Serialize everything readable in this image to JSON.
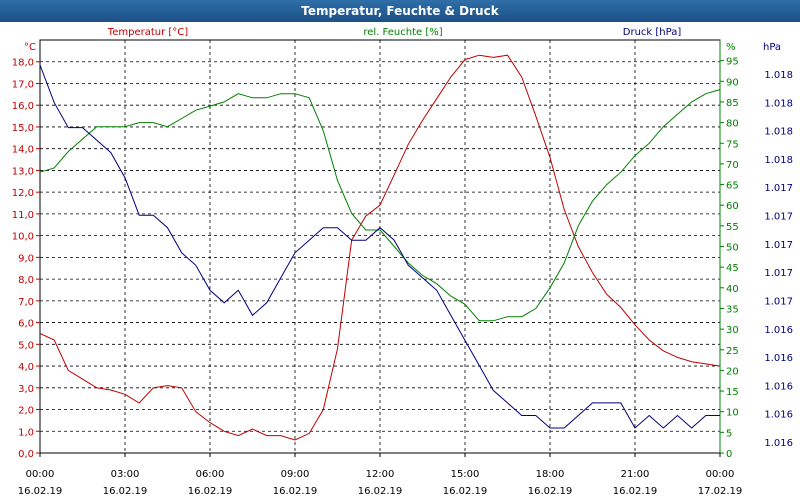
{
  "window": {
    "title": "Temperatur, Feuchte & Druck"
  },
  "colors": {
    "temperature": "#c00000",
    "humidity": "#008000",
    "pressure": "#000080",
    "grid": "#000000",
    "title_bg": "#1c4f86"
  },
  "chart_data": {
    "type": "line",
    "title": "Temperatur, Feuchte & Druck",
    "series": [
      {
        "name": "Temperatur [°C]",
        "axis": "left",
        "unit": "°C",
        "ylim": [
          0,
          19
        ],
        "x": [
          0,
          0.5,
          1,
          1.5,
          2,
          2.5,
          3,
          3.5,
          4,
          4.5,
          5,
          5.5,
          6,
          6.5,
          7,
          7.5,
          8,
          8.5,
          9,
          9.5,
          10,
          10.5,
          11,
          11.5,
          12,
          12.5,
          13,
          13.5,
          14,
          14.5,
          15,
          15.5,
          16,
          16.5,
          17,
          17.5,
          18,
          18.5,
          19,
          19.5,
          20,
          20.5,
          21,
          21.5,
          22,
          22.5,
          23,
          23.5,
          24
        ],
        "values": [
          5.5,
          5.2,
          3.8,
          3.4,
          3.0,
          2.9,
          2.7,
          2.3,
          3.0,
          3.1,
          3.0,
          1.9,
          1.4,
          1.0,
          0.8,
          1.1,
          0.8,
          0.8,
          0.6,
          0.9,
          2.0,
          4.8,
          9.8,
          10.9,
          11.4,
          12.8,
          14.2,
          15.3,
          16.3,
          17.3,
          18.1,
          18.3,
          18.2,
          18.3,
          17.3,
          15.5,
          13.6,
          11.2,
          9.5,
          8.3,
          7.3,
          6.7,
          5.9,
          5.2,
          4.7,
          4.4,
          4.2,
          4.1,
          4.0
        ]
      },
      {
        "name": "rel. Feuchte [%]",
        "axis": "right1",
        "unit": "%",
        "ylim": [
          0,
          100
        ],
        "x": [
          0,
          0.5,
          1,
          1.5,
          2,
          2.5,
          3,
          3.5,
          4,
          4.5,
          5,
          5.5,
          6,
          6.5,
          7,
          7.5,
          8,
          8.5,
          9,
          9.5,
          10,
          10.5,
          11,
          11.5,
          12,
          12.5,
          13,
          13.5,
          14,
          14.5,
          15,
          15.5,
          16,
          16.5,
          17,
          17.5,
          18,
          18.5,
          19,
          19.5,
          20,
          20.5,
          21,
          21.5,
          22,
          22.5,
          23,
          23.5,
          24
        ],
        "values": [
          68,
          69,
          73,
          76,
          79,
          79,
          79,
          80,
          80,
          79,
          81,
          83,
          84,
          85,
          87,
          86,
          86,
          87,
          87,
          86,
          78,
          66,
          58,
          54,
          54,
          50,
          46,
          43,
          41,
          38,
          36,
          32,
          32,
          33,
          33,
          35,
          40,
          46,
          55,
          61,
          65,
          68,
          72,
          75,
          79,
          82,
          85,
          87,
          88
        ]
      },
      {
        "name": "Druck [hPa]",
        "axis": "right2",
        "unit": "hPa",
        "ylim": [
          1015.5,
          1018.8
        ],
        "x": [
          0,
          0.5,
          1,
          1.5,
          2,
          2.5,
          3,
          3.5,
          4,
          4.5,
          5,
          5.5,
          6,
          6.5,
          7,
          7.5,
          8,
          8.5,
          9,
          9.5,
          10,
          10.5,
          11,
          11.5,
          12,
          12.5,
          13,
          13.5,
          14,
          14.5,
          15,
          15.5,
          16,
          16.5,
          17,
          17.5,
          18,
          18.5,
          19,
          19.5,
          20,
          20.5,
          21,
          21.5,
          22,
          22.5,
          23,
          23.5,
          24
        ],
        "values": [
          1018.6,
          1018.3,
          1018.1,
          1018.1,
          1018.0,
          1017.9,
          1017.7,
          1017.4,
          1017.4,
          1017.3,
          1017.1,
          1017.0,
          1016.8,
          1016.7,
          1016.8,
          1016.6,
          1016.7,
          1016.9,
          1017.1,
          1017.2,
          1017.3,
          1017.3,
          1017.2,
          1017.2,
          1017.3,
          1017.2,
          1017.0,
          1016.9,
          1016.8,
          1016.6,
          1016.4,
          1016.2,
          1016.0,
          1015.9,
          1015.8,
          1015.8,
          1015.7,
          1015.7,
          1015.8,
          1015.9,
          1015.9,
          1015.9,
          1015.7,
          1015.8,
          1015.7,
          1015.8,
          1015.7,
          1015.8,
          1015.8
        ]
      }
    ],
    "x_ticks": [
      {
        "t": "00:00",
        "d": "16.02.19"
      },
      {
        "t": "03:00",
        "d": "16.02.19"
      },
      {
        "t": "06:00",
        "d": "16.02.19"
      },
      {
        "t": "09:00",
        "d": "16.02.19"
      },
      {
        "t": "12:00",
        "d": "16.02.19"
      },
      {
        "t": "15:00",
        "d": "16.02.19"
      },
      {
        "t": "18:00",
        "d": "16.02.19"
      },
      {
        "t": "21:00",
        "d": "16.02.19"
      },
      {
        "t": "00:00",
        "d": "17.02.19"
      }
    ],
    "xlim": [
      0,
      24
    ],
    "left_axis": {
      "label": "°C",
      "ticks": [
        "0,0",
        "1,0",
        "2,0",
        "3,0",
        "4,0",
        "5,0",
        "6,0",
        "7,0",
        "8,0",
        "9,0",
        "10,0",
        "11,0",
        "12,0",
        "13,0",
        "14,0",
        "15,0",
        "16,0",
        "17,0",
        "18,0"
      ]
    },
    "right_axis1": {
      "label": "%",
      "ticks": [
        "0",
        "5",
        "10",
        "15",
        "20",
        "25",
        "30",
        "35",
        "40",
        "45",
        "50",
        "55",
        "60",
        "65",
        "70",
        "75",
        "80",
        "85",
        "90",
        "95"
      ]
    },
    "right_axis2": {
      "label": "hPa",
      "ticks": [
        "1.016",
        "1.016",
        "1.016",
        "1.016",
        "1.016",
        "1.017",
        "1.017",
        "1.017",
        "1.017",
        "1.017",
        "1.018",
        "1.018",
        "1.018",
        "1.018"
      ]
    },
    "legend": {
      "placement": "top"
    },
    "grid": true
  }
}
